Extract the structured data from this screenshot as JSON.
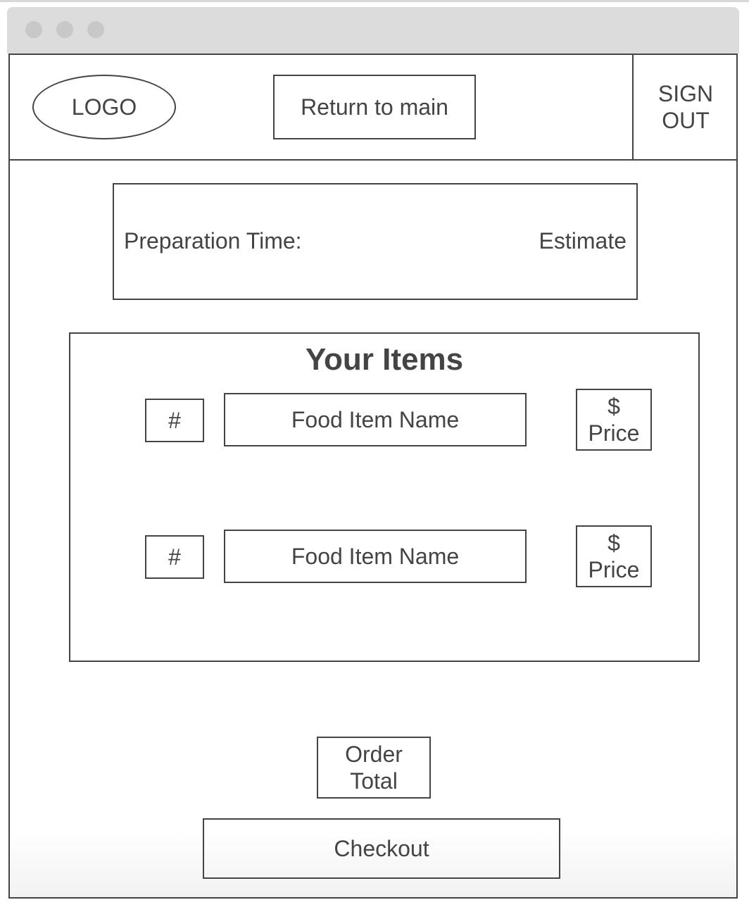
{
  "header": {
    "logo_label": "LOGO",
    "return_label": "Return to main",
    "signout_label": "SIGN OUT"
  },
  "prep": {
    "label": "Preparation Time:",
    "value": "Estimate"
  },
  "items": {
    "title": "Your Items",
    "rows": [
      {
        "qty": "#",
        "name": "Food Item Name",
        "price": "$ Price"
      },
      {
        "qty": "#",
        "name": "Food Item Name",
        "price": "$ Price"
      }
    ]
  },
  "footer": {
    "order_total_label": "Order Total",
    "checkout_label": "Checkout"
  }
}
